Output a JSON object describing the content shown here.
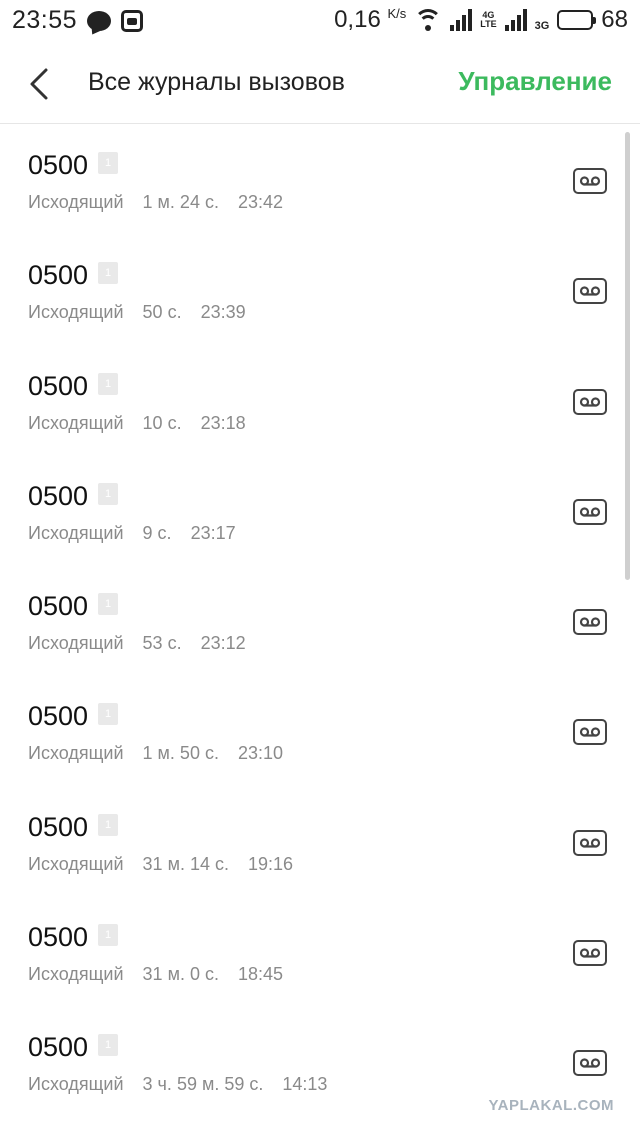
{
  "status_bar": {
    "time": "23:55",
    "speed": "0,16",
    "speed_unit": "K/s",
    "net_4g_top": "4G",
    "net_4g_bottom": "LTE",
    "net_3g": "3G",
    "battery_percent": "68",
    "battery_level": 0.68
  },
  "header": {
    "title": "Все журналы вызовов",
    "manage_label": "Управление"
  },
  "calls": [
    {
      "number": "0500",
      "sim": "1",
      "type": "Исходящий",
      "duration": "1 м. 24 с.",
      "time": "23:42"
    },
    {
      "number": "0500",
      "sim": "1",
      "type": "Исходящий",
      "duration": "50 с.",
      "time": "23:39"
    },
    {
      "number": "0500",
      "sim": "1",
      "type": "Исходящий",
      "duration": "10 с.",
      "time": "23:18"
    },
    {
      "number": "0500",
      "sim": "1",
      "type": "Исходящий",
      "duration": "9 с.",
      "time": "23:17"
    },
    {
      "number": "0500",
      "sim": "1",
      "type": "Исходящий",
      "duration": "53 с.",
      "time": "23:12"
    },
    {
      "number": "0500",
      "sim": "1",
      "type": "Исходящий",
      "duration": "1 м. 50 с.",
      "time": "23:10"
    },
    {
      "number": "0500",
      "sim": "1",
      "type": "Исходящий",
      "duration": "31 м. 14 с.",
      "time": "19:16"
    },
    {
      "number": "0500",
      "sim": "1",
      "type": "Исходящий",
      "duration": "31 м. 0 с.",
      "time": "18:45"
    },
    {
      "number": "0500",
      "sim": "1",
      "type": "Исходящий",
      "duration": "3 ч. 59 м. 59 с.",
      "time": "14:13"
    }
  ],
  "watermark": "YAPLAKAL.COM",
  "colors": {
    "accent": "#3cba5e",
    "meta_text": "#8a8a8a"
  }
}
